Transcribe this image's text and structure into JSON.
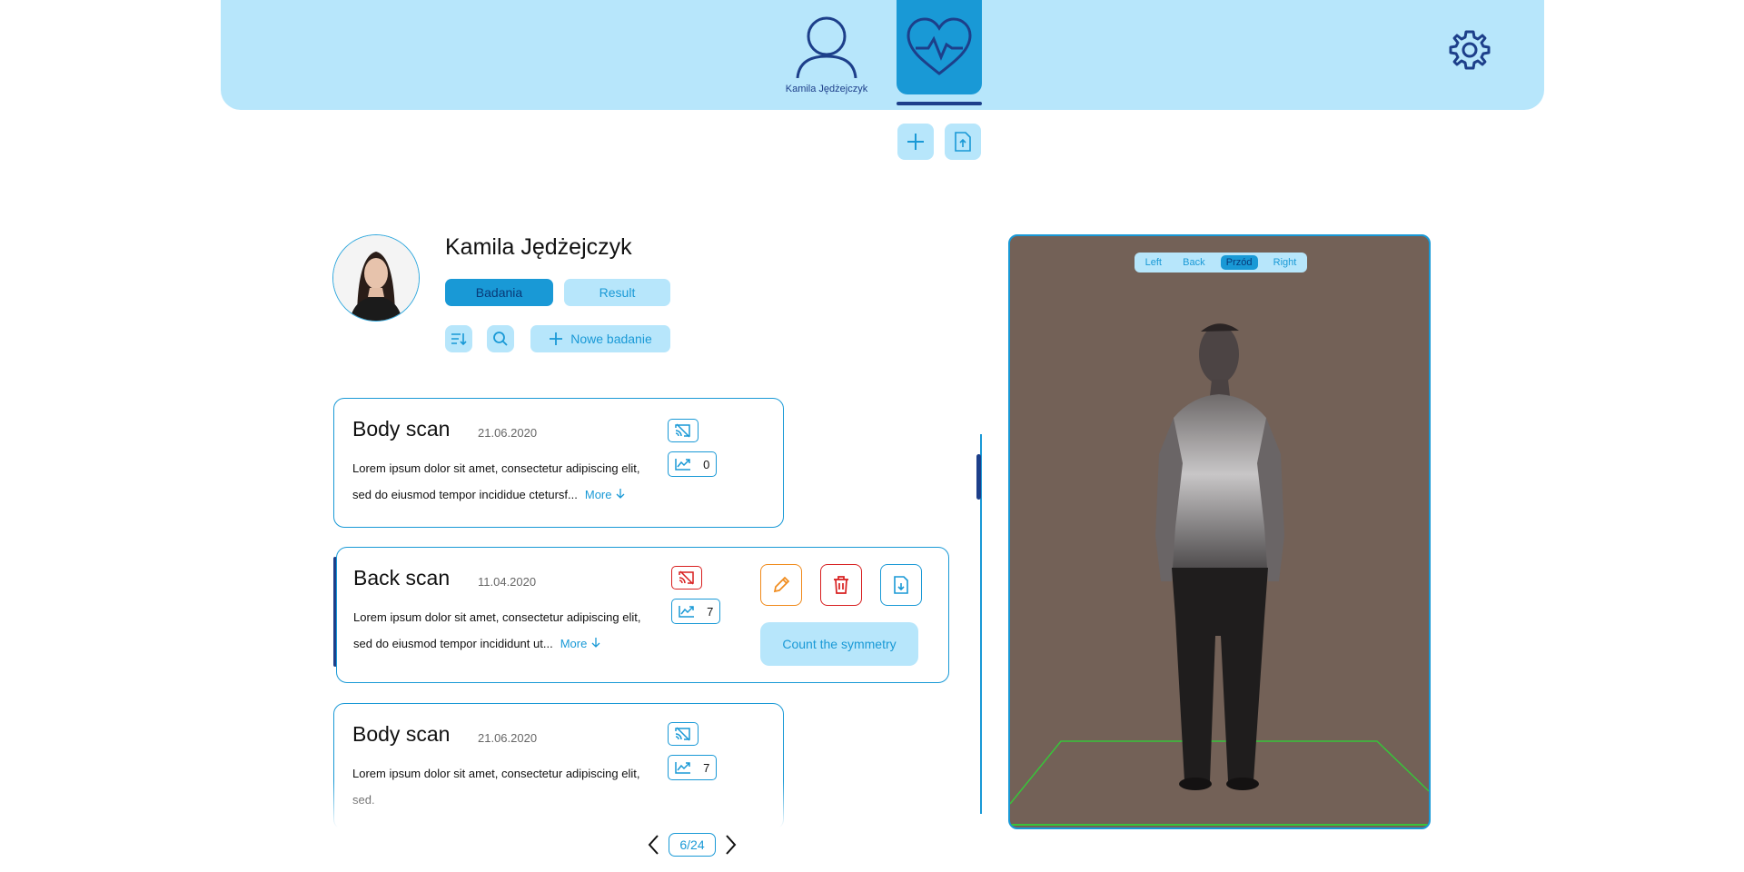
{
  "header": {
    "user_name": "Kamila Jędżejczyk"
  },
  "patient": {
    "name": "Kamila Jędżejczyk",
    "tabs": [
      {
        "label": "Badania",
        "active": true
      },
      {
        "label": "Result",
        "active": false
      }
    ],
    "new_study_label": "Nowe badanie"
  },
  "cards": [
    {
      "title": "Body scan",
      "date": "21.06.2020",
      "desc": "Lorem ipsum dolor sit amet, consectetur adipiscing elit, sed do eiusmod tempor incididue ctetursf...",
      "more": "More",
      "count": "0"
    },
    {
      "title": "Back scan",
      "date": "11.04.2020",
      "desc": "Lorem ipsum dolor sit amet, consectetur adipiscing elit, sed do eiusmod tempor incididunt ut...",
      "more": "More",
      "count": "7",
      "symmetry_label": "Count the symmetry"
    },
    {
      "title": "Body scan",
      "date": "21.06.2020",
      "desc": "Lorem ipsum dolor sit amet, consectetur adipiscing elit, sed.",
      "count": "7"
    }
  ],
  "pagination": {
    "label": "6/24"
  },
  "viewer": {
    "views": [
      "Left",
      "Back",
      "Przód",
      "Right"
    ],
    "active_view": "Przód"
  },
  "colors": {
    "header_bg": "#b7e6fb",
    "accent": "#1999d6",
    "dark_blue": "#1d3f8a",
    "edit": "#f08a1a",
    "delete": "#d81f1f",
    "viewer_bg": "#736157"
  }
}
